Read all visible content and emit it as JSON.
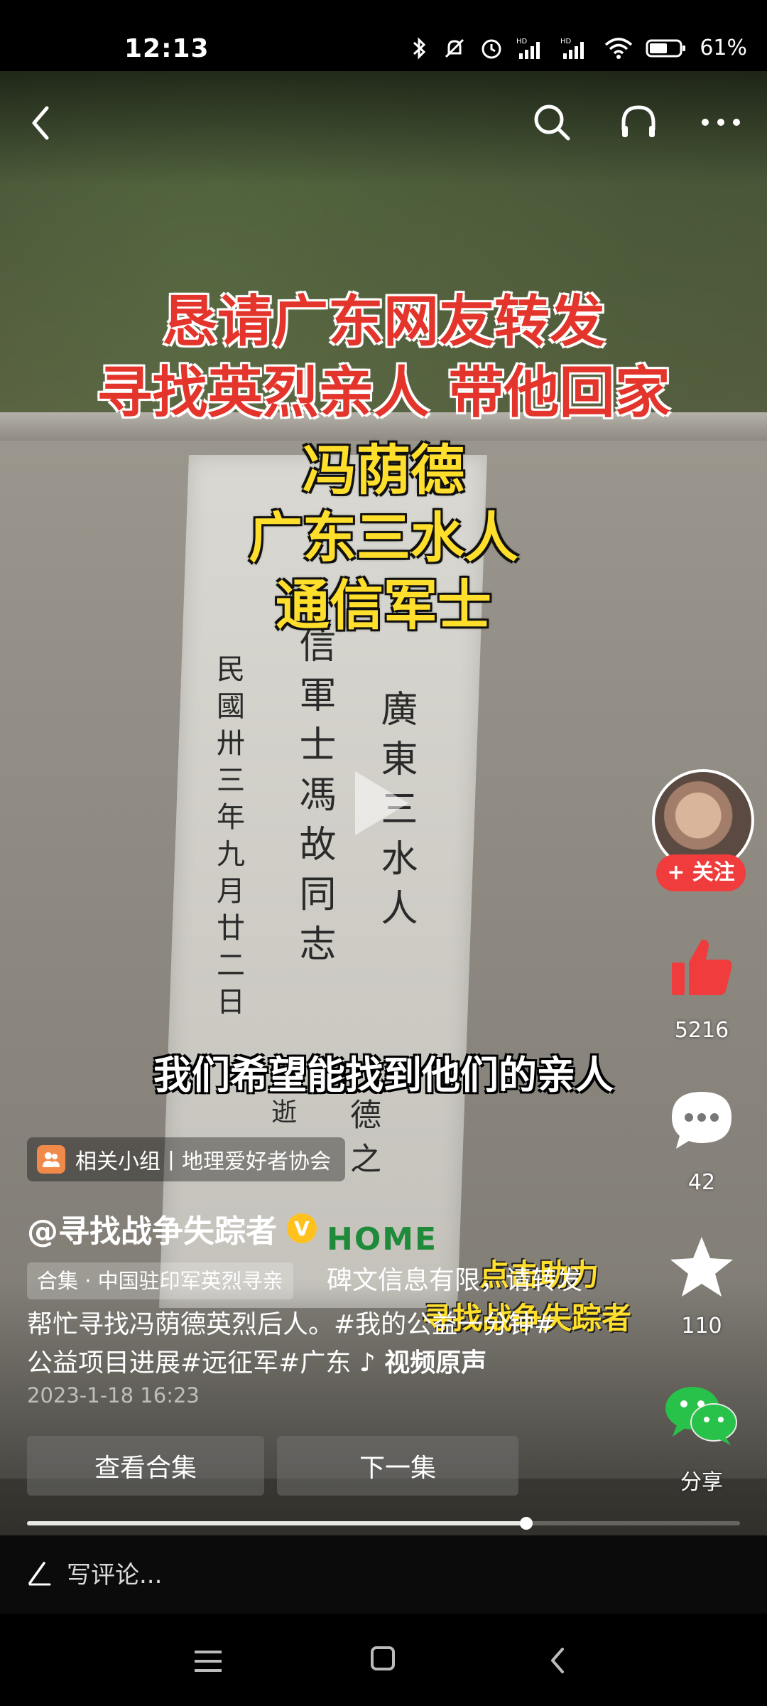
{
  "status": {
    "time": "12:13",
    "battery": "61%",
    "battery_level": 0.61,
    "icons": [
      "bluetooth-icon",
      "mute-icon",
      "alarm-icon",
      "signal-hd-1-icon",
      "signal-hd-2-icon",
      "wifi-icon",
      "battery-icon"
    ]
  },
  "nav": {
    "icons": [
      "back-icon",
      "search-icon",
      "headset-icon",
      "more-icon"
    ]
  },
  "video": {
    "title_line1": "恳请广东网友转发",
    "title_line2": "寻找英烈亲人 带他回家",
    "name": "冯荫德",
    "hometown": "广东三水人",
    "rank": "通信军士",
    "subtitle": "我们希望能找到他们的亲人",
    "inscription_col1": "廣東三水人",
    "inscription_col2": "信軍士馮故同志",
    "inscription_col3": "民國卅三年九月廿二日",
    "inscription_col4": "德之",
    "inscription_col5": "逝",
    "watermark_line1": "点击助力",
    "watermark_line2": "寻找战争失踪者",
    "logo_text": "HOME"
  },
  "actions": {
    "follow_label": "+ 关注",
    "likes": "5216",
    "comments": "42",
    "favorites": "110",
    "share_label": "分享",
    "colors": {
      "like": "#f03c3c",
      "follow": "#f03c3c",
      "share": "#28c24a"
    }
  },
  "caption": {
    "group_label": "相关小组丨地理爱好者协会",
    "author": "@寻找战争失踪者",
    "verified_badge": "V",
    "collection": "合集 · 中国驻印军英烈寻亲",
    "desc_line1": "碑文信息有限，请转发",
    "desc_line2": "帮忙寻找冯荫德英烈后人。#我的公益一分钟#",
    "desc_line3": "公益项目进展#远征军#广东",
    "music": "♪ 视频原声",
    "date": "2023-1-18 16:23"
  },
  "buttons": {
    "view_collection": "查看合集",
    "next_episode": "下一集"
  },
  "progress": {
    "played_fraction": 0.7
  },
  "comment": {
    "placeholder": "写评论..."
  }
}
